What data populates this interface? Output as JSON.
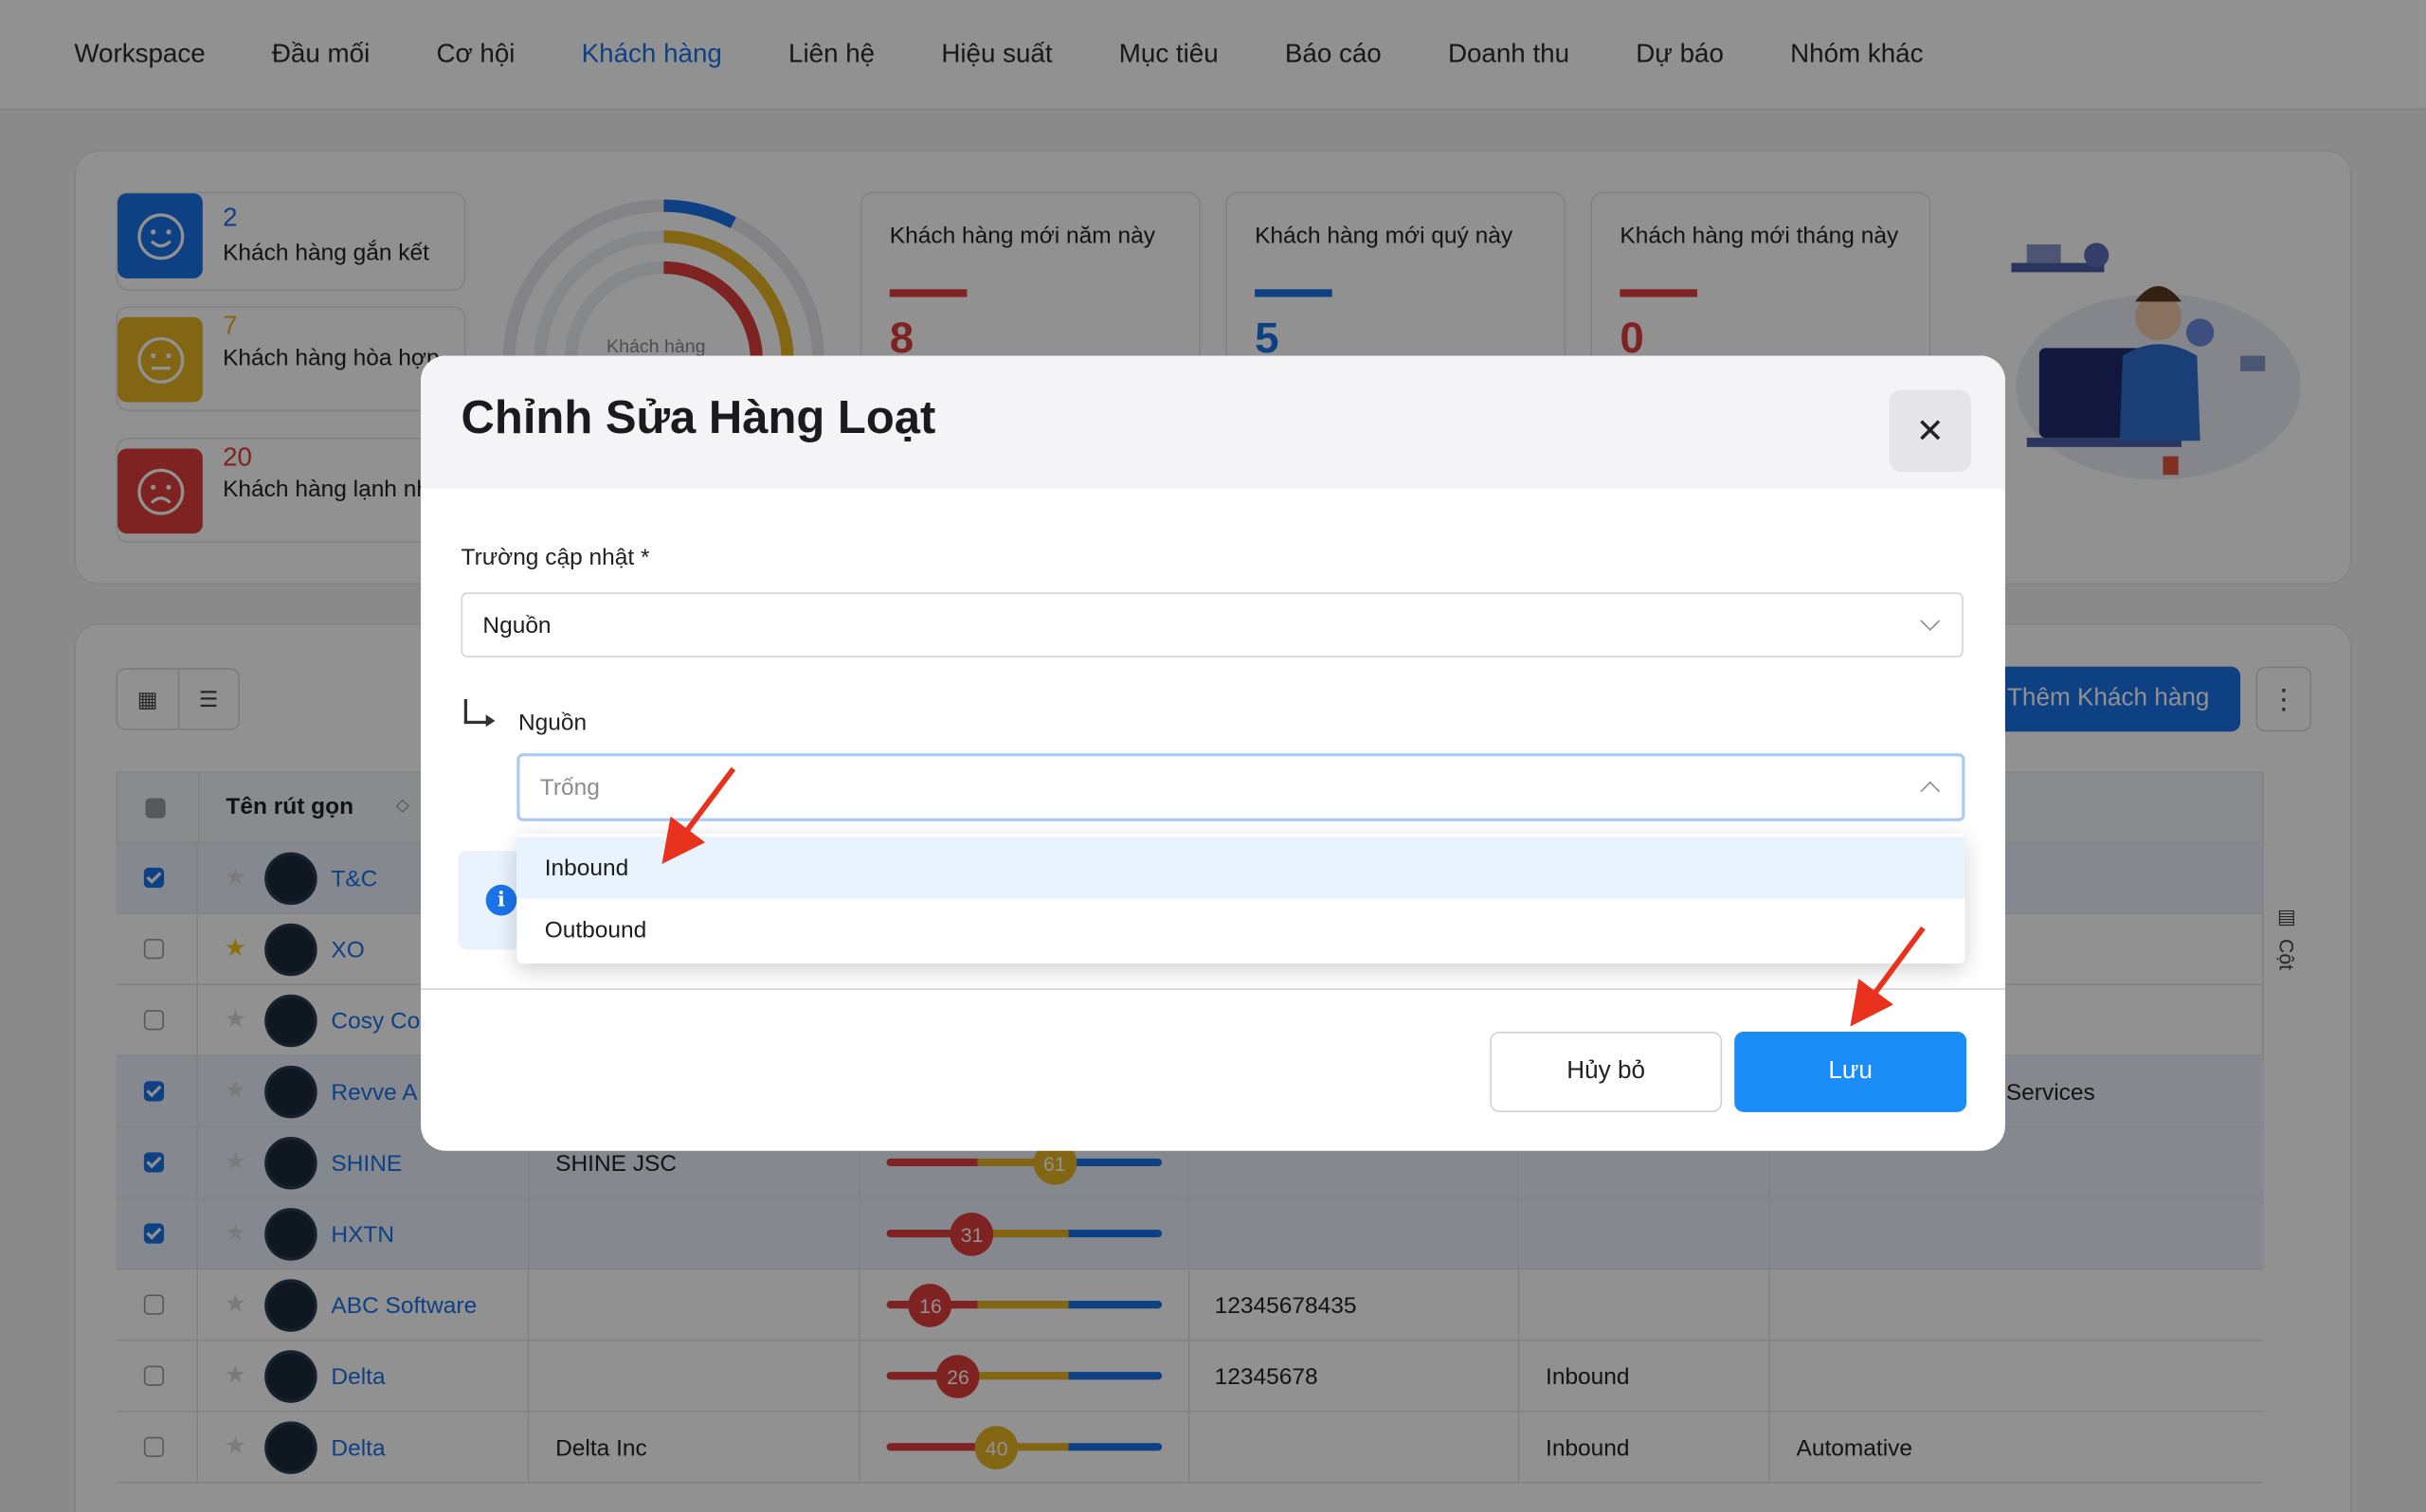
{
  "nav": {
    "items": [
      {
        "label": "Workspace",
        "active": false
      },
      {
        "label": "Đầu mối",
        "active": false
      },
      {
        "label": "Cơ hội",
        "active": false
      },
      {
        "label": "Khách hàng",
        "active": true
      },
      {
        "label": "Liên hệ",
        "active": false
      },
      {
        "label": "Hiệu suất",
        "active": false
      },
      {
        "label": "Mục tiêu",
        "active": false
      },
      {
        "label": "Báo cáo",
        "active": false
      },
      {
        "label": "Doanh thu",
        "active": false
      },
      {
        "label": "Dự báo",
        "active": false
      },
      {
        "label": "Nhóm khác",
        "active": false
      }
    ]
  },
  "summary": {
    "sentiments": [
      {
        "count": "2",
        "label": "Khách hàng gắn kết",
        "color": "#1a73e8",
        "icon": "smile-icon"
      },
      {
        "count": "7",
        "label": "Khách hàng hòa hợp",
        "color": "#e6b422",
        "icon": "neutral-face-icon"
      },
      {
        "count": "20",
        "label": "Khách hàng lạnh nhạt",
        "color": "#e03c3c",
        "icon": "sad-face-icon"
      }
    ],
    "donut_label": "Khách hàng",
    "stats": [
      {
        "label": "Khách hàng mới năm này",
        "value": "8",
        "color": "#e03c3c"
      },
      {
        "label": "Khách hàng mới quý này",
        "value": "5",
        "color": "#1a73e8"
      },
      {
        "label": "Khách hàng mới tháng này",
        "value": "0",
        "color": "#e03c3c"
      }
    ]
  },
  "toolbar": {
    "add_label": "Thêm Khách hàng",
    "more_icon": "more-vertical-icon",
    "columns_label": "Cột"
  },
  "table": {
    "header_name": "Tên rút gọn",
    "rows": [
      {
        "checked": true,
        "starred": false,
        "name": "T&C",
        "company": "",
        "score": null,
        "phone": "",
        "source": "",
        "industry": ""
      },
      {
        "checked": false,
        "starred": true,
        "name": "XO",
        "company": "",
        "score": null,
        "phone": "",
        "source": "",
        "industry": ""
      },
      {
        "checked": false,
        "starred": false,
        "name": "Cosy Co",
        "company": "",
        "score": null,
        "phone": "",
        "source": "",
        "industry": ""
      },
      {
        "checked": true,
        "starred": false,
        "name": "Revve A",
        "company": "",
        "score": null,
        "phone": "",
        "source": "",
        "industry": "hology and Services"
      },
      {
        "checked": true,
        "starred": false,
        "name": "SHINE",
        "company": "SHINE JSC",
        "score": 61,
        "phone": "",
        "source": "",
        "industry": ""
      },
      {
        "checked": true,
        "starred": false,
        "name": "HXTN",
        "company": "",
        "score": 31,
        "phone": "",
        "source": "",
        "industry": ""
      },
      {
        "checked": false,
        "starred": false,
        "name": "ABC Software",
        "company": "",
        "score": 16,
        "phone": "12345678435",
        "source": "",
        "industry": ""
      },
      {
        "checked": false,
        "starred": false,
        "name": "Delta",
        "company": "",
        "score": 26,
        "phone": "12345678",
        "source": "Inbound",
        "industry": ""
      },
      {
        "checked": false,
        "starred": false,
        "name": "Delta",
        "company": "Delta Inc",
        "score": 40,
        "phone": "",
        "source": "Inbound",
        "industry": "Automative"
      }
    ]
  },
  "modal": {
    "title": "Chỉnh Sửa Hàng Loạt",
    "close_icon": "close-icon",
    "field_label": "Trường cập nhật *",
    "field_value": "Nguồn",
    "sub_label": "Nguồn",
    "sub_placeholder": "Trống",
    "options": [
      "Inbound",
      "Outbound"
    ],
    "highlighted_option": "Inbound",
    "cancel_label": "Hủy bỏ",
    "save_label": "Lưu"
  },
  "colors": {
    "accent": "#1a73e8",
    "save_button": "#1a8cf5",
    "annotation_arrow": "#e8321e"
  }
}
